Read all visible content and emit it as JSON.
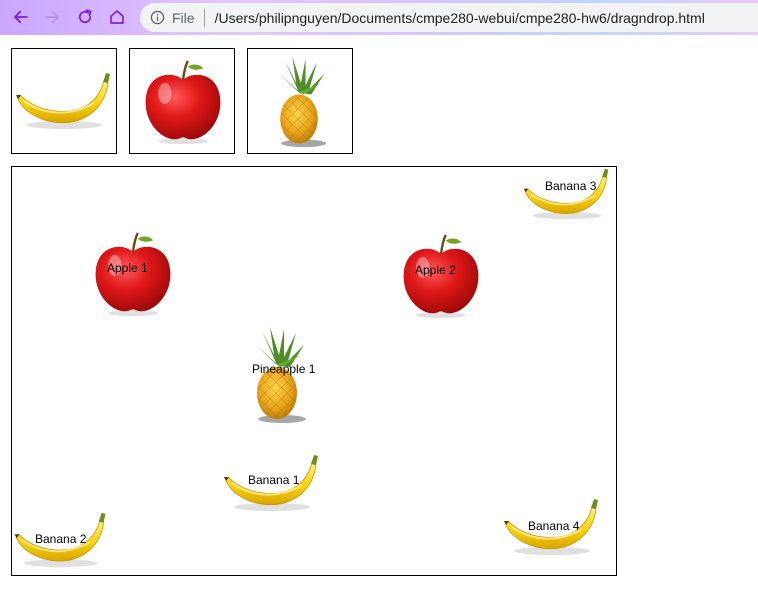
{
  "browser": {
    "address": {
      "scheme_label": "File",
      "url": "/Users/philipnguyen/Documents/cmpe280-webui/cmpe280-hw6/dragndrop.html"
    },
    "accent_color": "#7b1fdc"
  },
  "palette": [
    {
      "fruit": "banana",
      "icon": "banana-icon"
    },
    {
      "fruit": "apple",
      "icon": "apple-icon"
    },
    {
      "fruit": "pineapple",
      "icon": "pineapple-icon"
    }
  ],
  "drop_area": {
    "items": [
      {
        "label": "Banana 3",
        "fruit": "banana"
      },
      {
        "label": "Apple 1",
        "fruit": "apple"
      },
      {
        "label": "Apple 2",
        "fruit": "apple"
      },
      {
        "label": "Pineapple 1",
        "fruit": "pineapple"
      },
      {
        "label": "Banana 1",
        "fruit": "banana"
      },
      {
        "label": "Banana 2",
        "fruit": "banana"
      },
      {
        "label": "Banana 4",
        "fruit": "banana"
      }
    ]
  }
}
